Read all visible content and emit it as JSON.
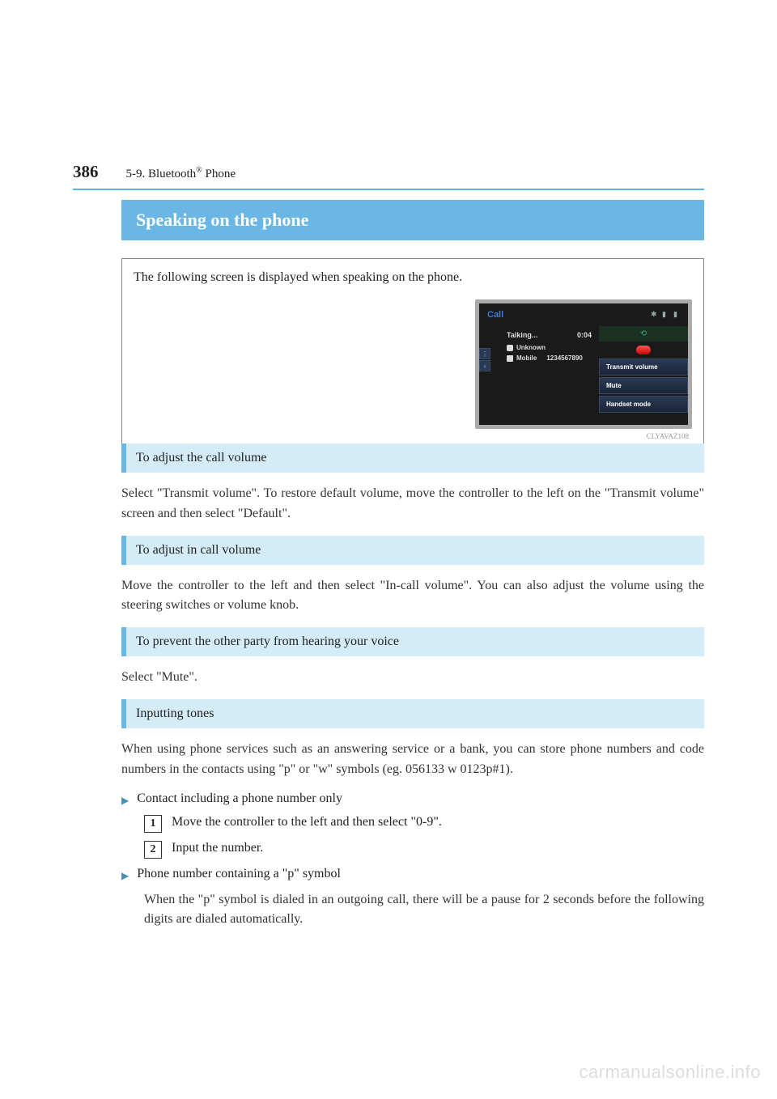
{
  "header": {
    "page_number": "386",
    "section_label_prefix": "5-9. Bluetooth",
    "section_label_sup": "®",
    "section_label_suffix": " Phone"
  },
  "title": "Speaking on the phone",
  "intro": "The following screen is displayed when speaking on the phone.",
  "screenshot": {
    "title": "Call",
    "talking": "Talking...",
    "time": "0:04",
    "unknown": "Unknown",
    "mobile": "Mobile",
    "number": "1234567890",
    "btn_transmit": "Transmit volume",
    "btn_mute": "Mute",
    "btn_handset": "Handset mode",
    "chevron": "‹",
    "fig_id": "CLYAVAZ108"
  },
  "sections": [
    {
      "heading": "To adjust the call volume",
      "body": "Select \"Transmit volume\". To restore default volume, move the controller to the left on the \"Transmit volume\" screen and then select \"Default\"."
    },
    {
      "heading": "To adjust in call volume",
      "body": "Move the controller to the left and then select \"In-call volume\". You can also adjust the volume using the steering switches or volume knob."
    },
    {
      "heading": "To prevent the other party from hearing your voice",
      "body": "Select \"Mute\"."
    },
    {
      "heading": "Inputting tones",
      "body": "When using phone services such as an answering service or a bank, you can store phone numbers and code numbers in the contacts using \"p\" or \"w\" symbols (eg. 056133 w 0123p#1)."
    }
  ],
  "bullets": {
    "b1": "Contact including a phone number only",
    "b2": "Phone number containing a \"p\" symbol"
  },
  "steps": {
    "s1_num": "1",
    "s1_text": "Move the controller to the left and then select \"0-9\".",
    "s2_num": "2",
    "s2_text": "Input the number."
  },
  "p_symbol_note": "When the \"p\" symbol is dialed in an outgoing call, there will be a pause for 2 seconds before the following digits are dialed automatically.",
  "watermark": "carmanualsonline.info"
}
